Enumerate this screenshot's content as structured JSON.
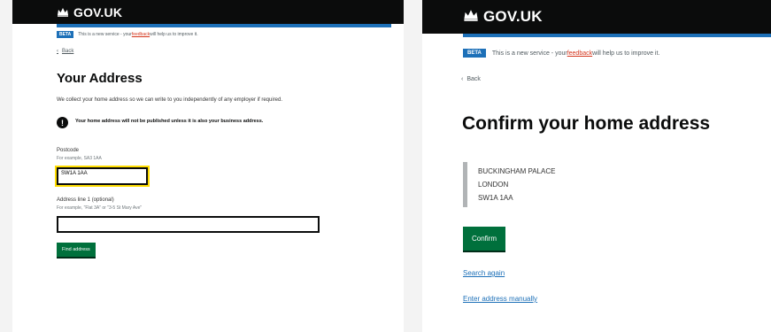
{
  "left": {
    "header": {
      "title": "GOV.UK"
    },
    "beta": {
      "tag": "BETA",
      "prefix": "This is a new service - your ",
      "link": "feedback",
      "suffix": " will help us to improve it."
    },
    "back": "Back",
    "title": "Your Address",
    "intro": "We collect your home address so we can write to you independently of any employer if required.",
    "warning": "Your home address will not be published unless it is also your business address.",
    "postcode": {
      "label": "Postcode",
      "hint": "For example, SA3 1AA",
      "value": "SW1A 1AA"
    },
    "line1": {
      "label": "Address line 1 (optional)",
      "hint": "For example, \"Flat 3A\" or \"3-5 St Mary Ave\"",
      "value": ""
    },
    "button": "Find address"
  },
  "right": {
    "header": {
      "title": "GOV.UK"
    },
    "beta": {
      "tag": "BETA",
      "prefix": "This is a new service - your ",
      "link": "feedback",
      "suffix": " will help us to improve it."
    },
    "back": "Back",
    "title": "Confirm your home address",
    "address": [
      "BUCKINGHAM PALACE",
      "LONDON",
      "SW1A 1AA"
    ],
    "button": "Confirm",
    "links": {
      "search_again": "Search again",
      "enter_manually": "Enter address manually"
    }
  }
}
